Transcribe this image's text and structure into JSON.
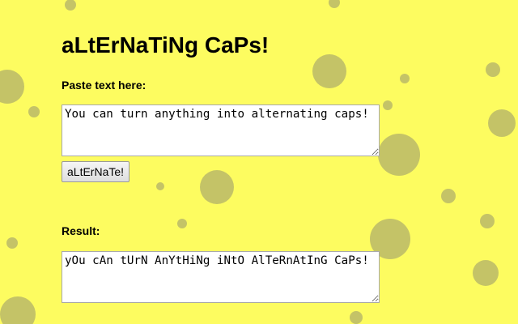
{
  "page": {
    "title": "aLtErNaTiNg CaPs!"
  },
  "input": {
    "label": "Paste text here:",
    "value": "You can turn anything into alternating caps!"
  },
  "convert_button": {
    "label": "aLtErNaTe!"
  },
  "output": {
    "label": "Result:",
    "value": "yOu cAn tUrN AnYtHiNg iNtO AlTeRnAtInG CaPs!"
  },
  "colors": {
    "background": "#fdfc60",
    "spots": "#c4c367"
  }
}
